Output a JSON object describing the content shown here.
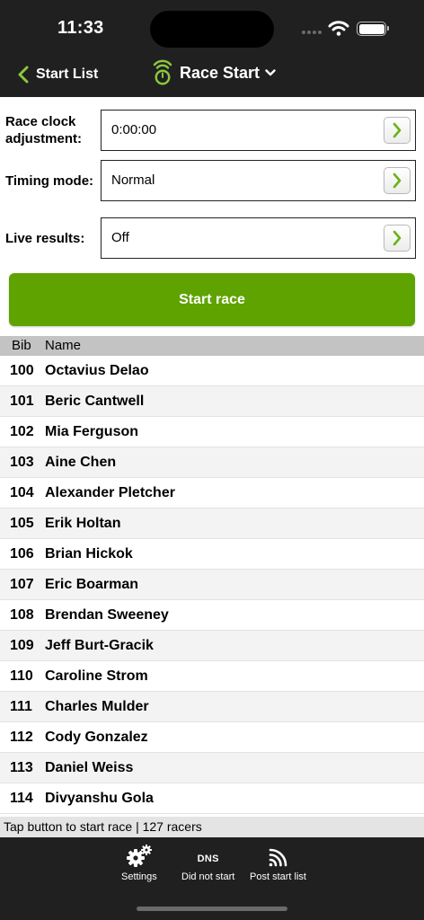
{
  "status_bar": {
    "time": "11:33"
  },
  "nav": {
    "back_label": "Start List",
    "title": "Race Start"
  },
  "form": [
    {
      "label_line1": "Race clock",
      "label_line2": "adjustment:",
      "value": "0:00:00"
    },
    {
      "label_line1": "Timing mode:",
      "label_line2": "",
      "value": "Normal"
    },
    {
      "label_line1": "Live results:",
      "label_line2": "",
      "value": "Off"
    }
  ],
  "start_button": {
    "label": "Start race"
  },
  "list": {
    "columns": {
      "bib": "Bib",
      "name": "Name"
    },
    "rows": [
      {
        "bib": "100",
        "name": "Octavius Delao"
      },
      {
        "bib": "101",
        "name": "Beric Cantwell"
      },
      {
        "bib": "102",
        "name": "Mia Ferguson"
      },
      {
        "bib": "103",
        "name": "Aine Chen"
      },
      {
        "bib": "104",
        "name": "Alexander Pletcher"
      },
      {
        "bib": "105",
        "name": "Erik Holtan"
      },
      {
        "bib": "106",
        "name": "Brian Hickok"
      },
      {
        "bib": "107",
        "name": "Eric Boarman"
      },
      {
        "bib": "108",
        "name": "Brendan Sweeney"
      },
      {
        "bib": "109",
        "name": "Jeff Burt-Gracik"
      },
      {
        "bib": "110",
        "name": "Caroline Strom"
      },
      {
        "bib": "111",
        "name": "Charles Mulder"
      },
      {
        "bib": "112",
        "name": "Cody Gonzalez"
      },
      {
        "bib": "113",
        "name": "Daniel Weiss"
      },
      {
        "bib": "114",
        "name": "Divyanshu Gola"
      }
    ]
  },
  "footer": {
    "status": "Tap button to start race | 127 racers"
  },
  "tabbar": {
    "settings": "Settings",
    "dns_icon_text": "DNS",
    "dns": "Did not start",
    "post": "Post start list"
  },
  "colors": {
    "accent_green": "#5ea300",
    "bar_dark": "#202020",
    "header_gray": "#c3c3c3"
  },
  "icons": {
    "back": "chevron-left-icon",
    "title": "stopwatch-icon",
    "title_dropdown": "chevron-down-icon",
    "field": "chevron-right-icon",
    "settings": "gears-icon",
    "post": "wifi-signal-icon"
  }
}
